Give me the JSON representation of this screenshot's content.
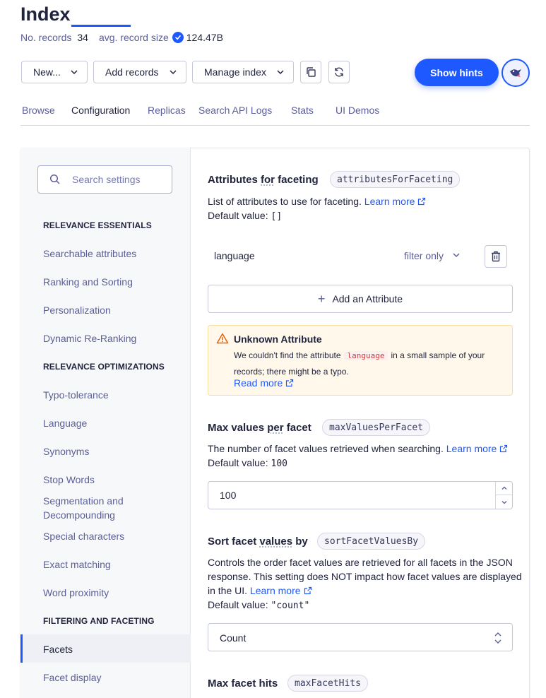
{
  "header": {
    "title": "Index",
    "records_label": "No. records",
    "records_value": "34",
    "size_label": "avg. record size",
    "size_value": "124.47B"
  },
  "toolbar": {
    "new_label": "New...",
    "add_records_label": "Add records",
    "manage_index_label": "Manage index",
    "show_hints_label": "Show hints"
  },
  "tabs": [
    {
      "label": "Browse"
    },
    {
      "label": "Configuration"
    },
    {
      "label": "Replicas"
    },
    {
      "label": "Search API Logs"
    },
    {
      "label": "Stats"
    },
    {
      "label": "UI Demos"
    }
  ],
  "sidebar": {
    "search_placeholder": "Search settings",
    "sections": [
      "RELEVANCE ESSENTIALS",
      "RELEVANCE OPTIMIZATIONS",
      "FILTERING AND FACETING"
    ],
    "items": [
      "Searchable attributes",
      "Ranking and Sorting",
      "Personalization",
      "Dynamic Re-Ranking",
      "Typo-tolerance",
      "Language",
      "Synonyms",
      "Stop Words",
      "Segmentation and Decompounding",
      "Special characters",
      "Exact matching",
      "Word proximity",
      "Facets",
      "Facet display"
    ],
    "active_item": "Facets"
  },
  "settings": {
    "faceting": {
      "title_a": "Attributes ",
      "title_b": "for",
      "title_c": " faceting",
      "param": "attributesForFaceting",
      "desc": "List of attributes to use for faceting.",
      "learn_more": "Learn more",
      "default_label": "Default value:",
      "default_value": "[]",
      "attribute": "language",
      "attribute_mode": "filter only",
      "add_label": "Add an Attribute"
    },
    "warning": {
      "title": "Unknown Attribute",
      "text_before": "We couldn't find the attribute",
      "code": "language",
      "text_after": "in a small sample of your records; there might be a typo.",
      "link": "Read more"
    },
    "max_values": {
      "title_a": "Max values ",
      "title_b": "per",
      "title_c": " facet",
      "param": "maxValuesPerFacet",
      "desc": "The number of facet values retrieved when searching.",
      "learn_more": "Learn more",
      "default_label": "Default value:",
      "default_value": "100",
      "value": "100"
    },
    "sort_facet": {
      "title_a": "Sort facet ",
      "title_b": "values",
      "title_c": " by",
      "param": "sortFacetValuesBy",
      "desc_1": "Controls the order facet values are retrieved for all facets in the JSON",
      "desc_2": "response. This setting does NOT impact how facet values are displayed",
      "desc_3": "in the UI.",
      "learn_more": "Learn more",
      "default_label": "Default value:",
      "default_value": "\"count\"",
      "value": "Count"
    },
    "max_facet_hits": {
      "title": "Max facet hits",
      "param": "maxFacetHits"
    }
  },
  "colors": {
    "accent": "#1e59ff",
    "text": "#21243d",
    "muted": "#5a5e9a",
    "warning_bg": "#fff8eb"
  }
}
